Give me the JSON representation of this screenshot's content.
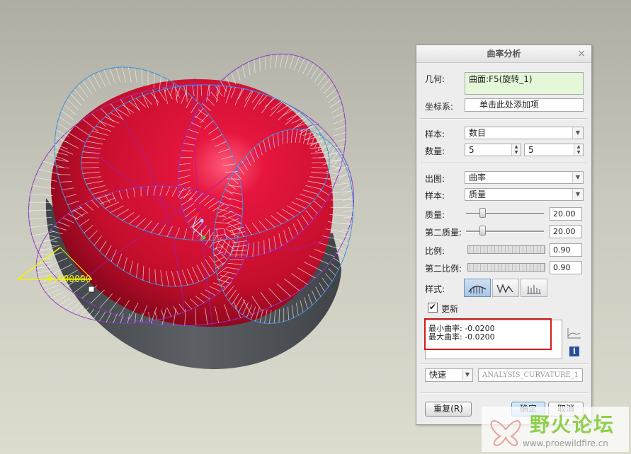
{
  "viewport": {
    "dimension_label": "0.900000",
    "colors": {
      "surface": "#c8102e",
      "bowl": "#52565a",
      "porcupine_blue": "#3a8ee0",
      "porcupine_purple": "#8a38c8",
      "dimension": "#f4f400"
    }
  },
  "dialog": {
    "title": "曲率分析",
    "close_icon": "×",
    "geometry": {
      "label": "几何:",
      "value": "曲面:F5(旋转_1)"
    },
    "coord_sys": {
      "label": "坐标系:",
      "value": "单击此处添加项"
    },
    "sample": {
      "label": "样本:",
      "value": "数目"
    },
    "count": {
      "label": "数量:",
      "value1": "5",
      "value2": "5"
    },
    "plot": {
      "label": "出图:",
      "value": "曲率"
    },
    "sample2": {
      "label": "样本:",
      "value": "质量"
    },
    "quality": {
      "label": "质量:",
      "value": "20.00",
      "level": 0.25
    },
    "quality2": {
      "label": "第二质量:",
      "value": "20.00",
      "level": 0.25
    },
    "scale": {
      "label": "比例:",
      "value": "0.90"
    },
    "scale2": {
      "label": "第二比例:",
      "value": "0.90"
    },
    "style": {
      "label": "样式:"
    },
    "update": {
      "label": "更新",
      "checked": true
    },
    "results": {
      "min": "最小曲率: -0.0200",
      "max": "最大曲率: -0.0200"
    },
    "mode": {
      "value": "快速"
    },
    "name": {
      "value": "ANALYSIS_CURVATURE_1"
    },
    "buttons": {
      "reset": "重复(R)",
      "ok": "确定",
      "cancel": "取消"
    }
  },
  "watermark": {
    "title": "野火论坛",
    "url": "www.proewildfire.cn"
  }
}
